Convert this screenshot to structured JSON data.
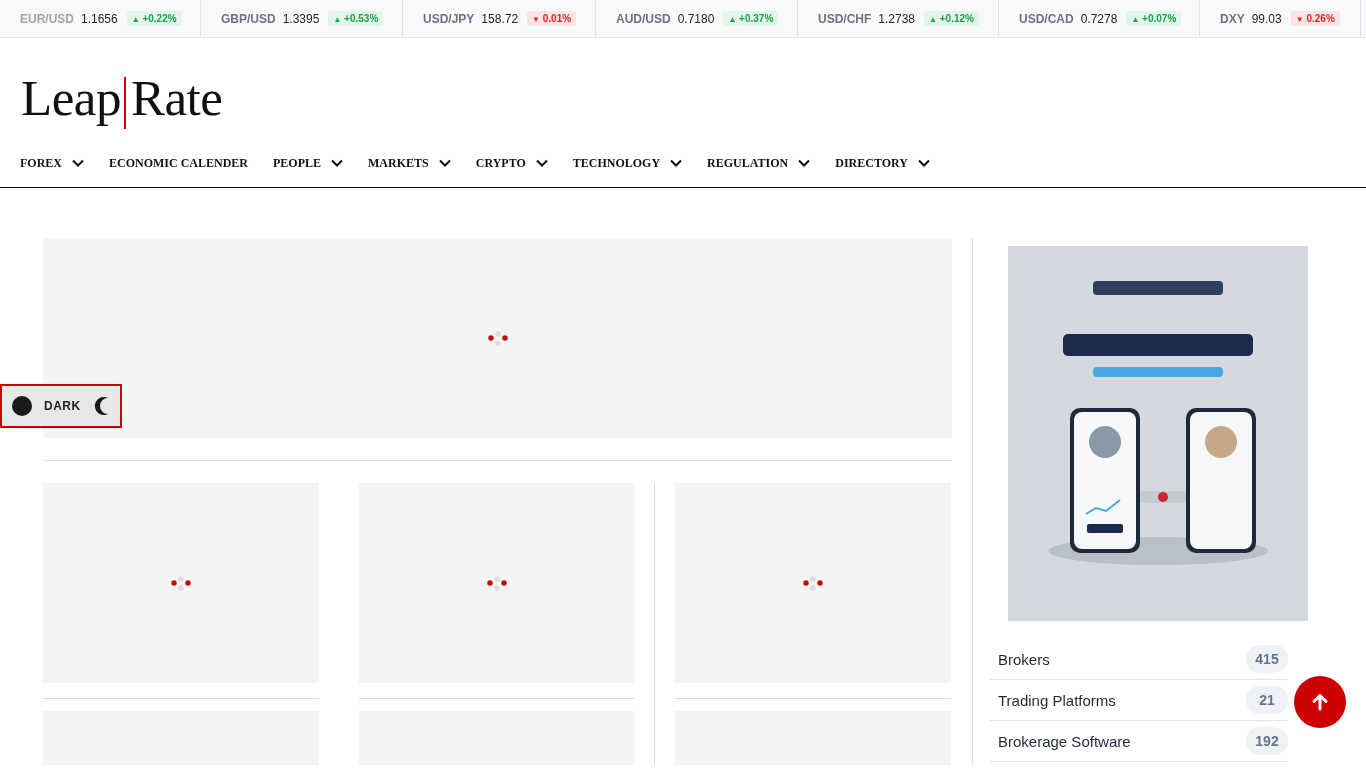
{
  "ticker": [
    {
      "pair": "EUR/USD",
      "price": "1.1656",
      "arrow": "▲",
      "change": "+0.22%",
      "rising": true
    },
    {
      "pair": "GBP/USD",
      "price": "1.3395",
      "arrow": "▲",
      "change": "+0.53%",
      "rising": true
    },
    {
      "pair": "USD/JPY",
      "price": "158.72",
      "arrow": "▼",
      "change": "0.01%",
      "rising": false
    },
    {
      "pair": "AUD/USD",
      "price": "0.7180",
      "arrow": "▲",
      "change": "+0.37%",
      "rising": true
    },
    {
      "pair": "USD/CHF",
      "price": "1.2738",
      "arrow": "▲",
      "change": "+0.12%",
      "rising": true
    },
    {
      "pair": "USD/CAD",
      "price": "0.7278",
      "arrow": "▲",
      "change": "+0.07%",
      "rising": true
    },
    {
      "pair": "DXY",
      "price": "99.03",
      "arrow": "▼",
      "change": "0.26%",
      "rising": false
    }
  ],
  "logo": {
    "left": "Leap",
    "right": "Rate"
  },
  "nav": [
    {
      "label": "FOREX",
      "dropdown": true
    },
    {
      "label": "ECONOMIC CALENDER",
      "dropdown": false
    },
    {
      "label": "PEOPLE",
      "dropdown": true
    },
    {
      "label": "MARKETS",
      "dropdown": true
    },
    {
      "label": "CRYPTO",
      "dropdown": true
    },
    {
      "label": "TECHNOLOGY",
      "dropdown": true
    },
    {
      "label": "REGULATION",
      "dropdown": true
    },
    {
      "label": "DIRECTORY",
      "dropdown": true
    }
  ],
  "theme_toggle": {
    "label": "DARK"
  },
  "content": {
    "featured": {
      "kind": "loading"
    },
    "cards": [
      {
        "kind": "loading"
      },
      {
        "kind": "loading"
      },
      {
        "kind": "loading"
      },
      {
        "kind": "empty"
      },
      {
        "kind": "empty"
      },
      {
        "kind": "empty"
      }
    ]
  },
  "sidebar": {
    "directory": [
      {
        "label": "Brokers",
        "count": "415"
      },
      {
        "label": "Trading Platforms",
        "count": "21"
      },
      {
        "label": "Brokerage Software",
        "count": "192"
      }
    ]
  }
}
